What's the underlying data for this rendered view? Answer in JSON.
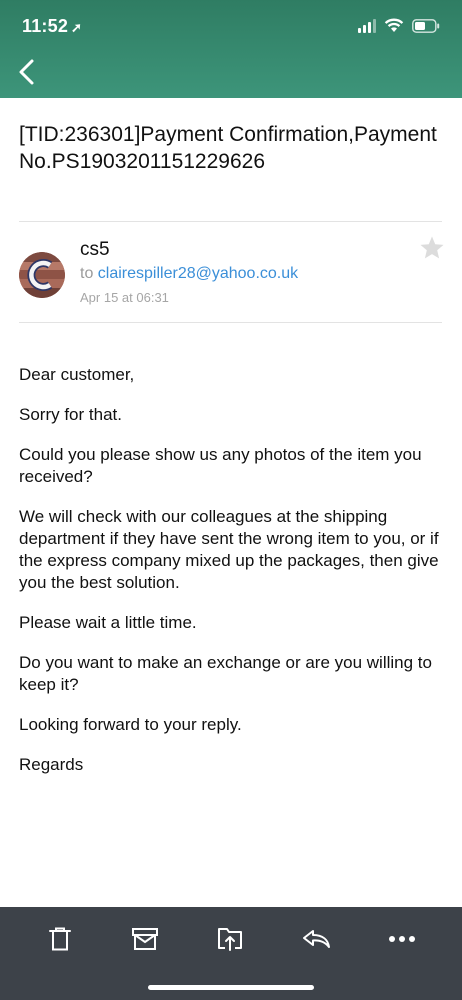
{
  "status_bar": {
    "time": "11:52",
    "location_glyph": "➚",
    "icons": [
      "signal-icon",
      "wifi-icon",
      "battery-icon"
    ]
  },
  "nav": {
    "back_icon": "chevron-left-icon"
  },
  "email": {
    "subject": "[TID:236301]Payment Confirmation,Payment No.PS1903201151229626",
    "sender": "cs5",
    "to_prefix": "to ",
    "to_address": "clairespiller28@yahoo.co.uk",
    "date": "Apr 15 at 06:31",
    "body": [
      "Dear customer,",
      "Sorry for that.",
      "Could you please show us any photos of the item you received?",
      "We will check with our colleagues at the shipping department if they have sent the wrong item to you, or if the express company mixed up the packages, then give you the best solution.",
      "Please wait a little time.",
      "Do you want to make an exchange or are you willing to keep it?",
      "Looking forward to your reply.",
      "Regards"
    ]
  },
  "toolbar": {
    "items": [
      "trash-icon",
      "archive-icon",
      "move-icon",
      "reply-icon",
      "more-icon"
    ]
  },
  "colors": {
    "header": "#3d957a",
    "link": "#3b8fd8",
    "toolbar": "#3d4249"
  }
}
